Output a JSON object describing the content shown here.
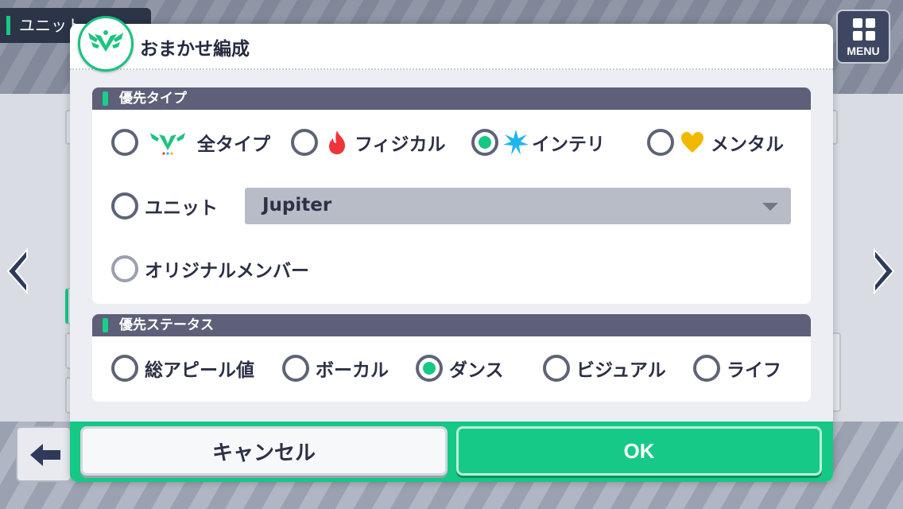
{
  "background": {
    "unit_tab_label": "ユニット",
    "menu_label": "MENU"
  },
  "dialog": {
    "title": "おまかせ編成",
    "type_section": {
      "header": "優先タイプ",
      "options": [
        {
          "label": "全タイプ",
          "icon": "all-type-emblem-icon",
          "selected": false
        },
        {
          "label": "フィジカル",
          "icon": "flame-icon",
          "selected": false
        },
        {
          "label": "インテリ",
          "icon": "star-burst-icon",
          "selected": true
        },
        {
          "label": "メンタル",
          "icon": "heart-icon",
          "selected": false
        }
      ],
      "unit_option": {
        "label": "ユニット",
        "selected": false
      },
      "unit_select_value": "Jupiter",
      "original_member_option": {
        "label": "オリジナルメンバー",
        "selected": false
      }
    },
    "status_section": {
      "header": "優先ステータス",
      "options": [
        {
          "label": "総アピール値",
          "selected": false
        },
        {
          "label": "ボーカル",
          "selected": false
        },
        {
          "label": "ダンス",
          "selected": true
        },
        {
          "label": "ビジュアル",
          "selected": false
        },
        {
          "label": "ライフ",
          "selected": false
        }
      ]
    },
    "cancel_label": "キャンセル",
    "ok_label": "OK"
  },
  "colors": {
    "accent": "#16c885",
    "section_header": "#5d6078",
    "text": "#2b3045",
    "flame": "#f0343c",
    "star": "#1eb6f0",
    "heart": "#f2b800"
  }
}
